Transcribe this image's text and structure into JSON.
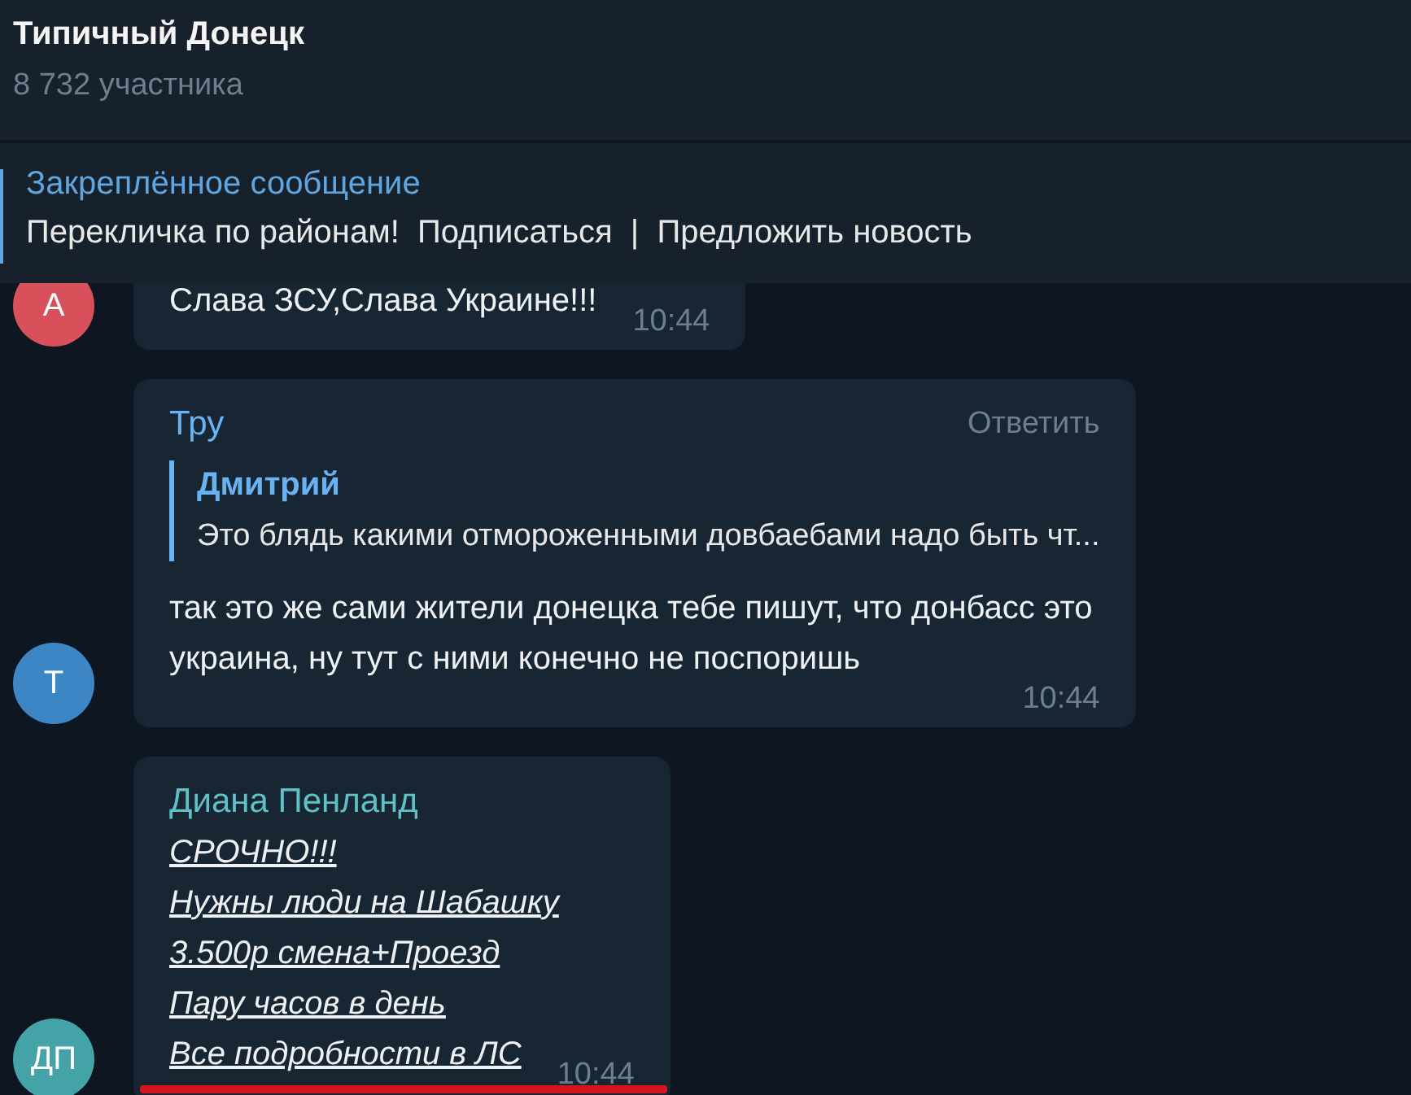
{
  "header": {
    "title": "Типичный Донецк",
    "subtitle": "8 732 участника"
  },
  "pinned": {
    "title": "Закреплённое сообщение",
    "text": "Перекличка по районам!  Подписаться  |  Предложить новость"
  },
  "messages": [
    {
      "avatar": "А",
      "color": "#d8505a",
      "kind": "plain",
      "text_lines": [
        "Слава ЗСУ,Слава Украине!!!"
      ],
      "time": "10:44",
      "marked": false
    },
    {
      "avatar": "Т",
      "color": "#3d86c6",
      "sender": {
        "name": "Тру",
        "color": "#6ab3f3"
      },
      "action": "Ответить",
      "reply": {
        "sender": "Дмитрий",
        "text": "Это блядь какими отмороженными довбаебами надо быть чт..."
      },
      "kind": "plain",
      "text_lines": [
        "так это же сами жители донецка тебе пишут, что донбасс это\nукраина, ну тут с ними конечно не поспоришь"
      ],
      "time": "10:44",
      "marked": false
    },
    {
      "avatar": "ДП",
      "color": "#44a3a6",
      "sender": {
        "name": "Диана Пенланд",
        "color": "#5fc1c6"
      },
      "kind": "formatted",
      "text_lines": [
        "СРОЧНО!!!",
        "Нужны люди на Шабашку",
        "3.500р смена+Проезд",
        "Пару часов в день",
        "Все подробности в ЛС"
      ],
      "time": "10:44",
      "marked": true
    }
  ]
}
